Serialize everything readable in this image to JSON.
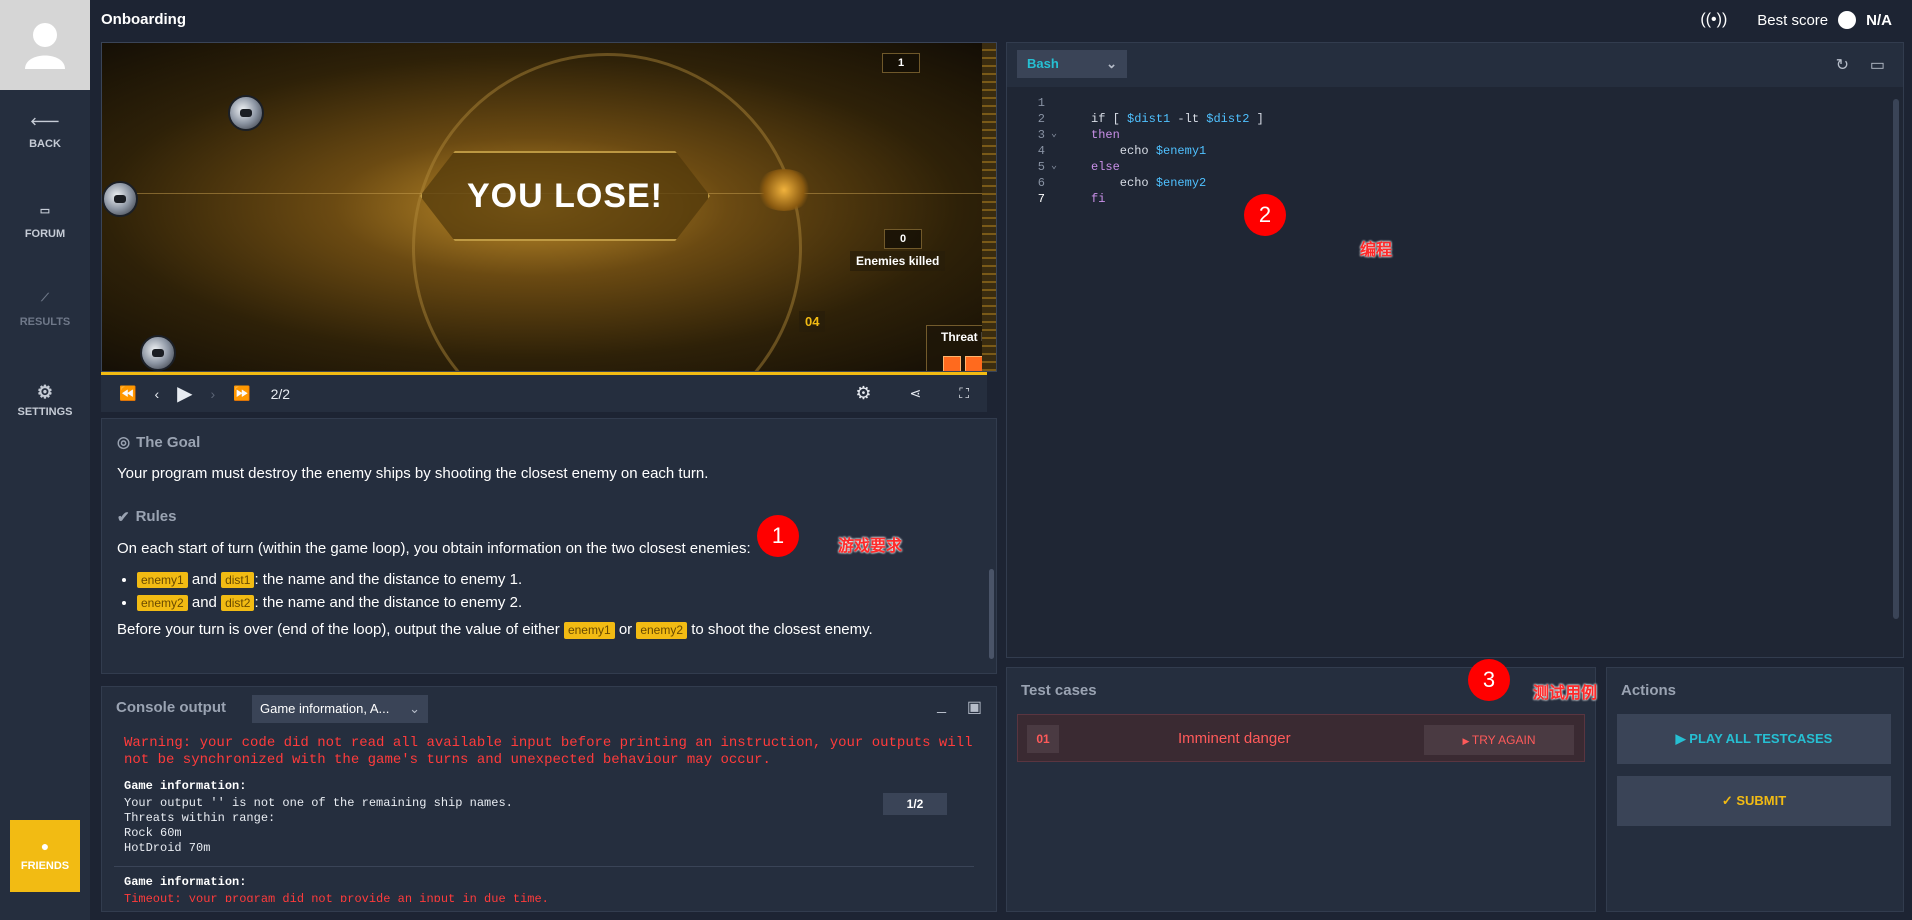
{
  "app": {
    "title": "Onboarding",
    "best_score_label": "Best score",
    "best_score_value": "N/A"
  },
  "sidebar": {
    "items": [
      {
        "label": "BACK",
        "icon": "arrow-left-icon"
      },
      {
        "label": "FORUM",
        "icon": "forum-icon"
      },
      {
        "label": "RESULTS",
        "icon": "chart-line-icon"
      },
      {
        "label": "SETTINGS",
        "icon": "gear-icon"
      }
    ],
    "friends_label": "FRIENDS"
  },
  "viewer": {
    "lose_text": "YOU LOSE!",
    "enemies_killed_label": "Enemies killed",
    "enemies_in_zone_count": "1",
    "enemies_killed_count": "0",
    "threat_label": "Threat level",
    "threat_number": "04",
    "frame": "2/2"
  },
  "statement": {
    "goal_title": "The Goal",
    "goal_text": "Your program must destroy the enemy ships by shooting the closest enemy on each turn.",
    "rules_title": "Rules",
    "rules_intro": "On each start of turn (within the game loop), you obtain information on the two closest enemies:",
    "bullet1": {
      "a": "enemy1",
      "and": "and",
      "b": "dist1",
      "text": ": the name and the distance to enemy 1."
    },
    "bullet2": {
      "a": "enemy2",
      "and": "and",
      "b": "dist2",
      "text": ": the name and the distance to enemy 2."
    },
    "outro_pre": "Before your turn is over (end of the loop), output the value of either",
    "outro_a": "enemy1",
    "outro_or": "or",
    "outro_b": "enemy2",
    "outro_post": "to shoot the closest enemy."
  },
  "console": {
    "title": "Console output",
    "select_value": "Game information, A...",
    "warning": "Warning: your code did not read all available input before printing an instruction, your outputs will not be synchronized with the game's turns and unexpected behaviour may occur.",
    "block1_title": "Game information:",
    "block1_lines": [
      "Your output '' is not one of the remaining ship names.",
      "Threats within range:",
      "Rock 60m",
      "HotDroid 70m"
    ],
    "frame_badge": "1/2",
    "block2_title": "Game information:",
    "block2_line": "Timeout: your program did not provide an input in due time."
  },
  "editor": {
    "language": "Bash",
    "lines": [
      {
        "n": "1",
        "parts": []
      },
      {
        "n": "2",
        "parts": [
          [
            "plain",
            "if [ "
          ],
          [
            "var",
            "$dist1"
          ],
          [
            "plain",
            " -lt "
          ],
          [
            "var",
            "$dist2"
          ],
          [
            "plain",
            " ]"
          ]
        ]
      },
      {
        "n": "3",
        "parts": [
          [
            "kw",
            "then"
          ]
        ]
      },
      {
        "n": "4",
        "parts": [
          [
            "plain",
            "    echo "
          ],
          [
            "var",
            "$enemy1"
          ]
        ]
      },
      {
        "n": "5",
        "parts": [
          [
            "kw",
            "else"
          ]
        ]
      },
      {
        "n": "6",
        "parts": [
          [
            "plain",
            "    echo "
          ],
          [
            "var",
            "$enemy2"
          ]
        ]
      },
      {
        "n": "7",
        "parts": [
          [
            "kw",
            "fi"
          ]
        ]
      }
    ]
  },
  "testcases": {
    "title": "Test cases",
    "items": [
      {
        "num": "01",
        "name": "Imminent danger",
        "action": "TRY AGAIN"
      }
    ]
  },
  "actions": {
    "title": "Actions",
    "play_all": "PLAY ALL TESTCASES",
    "submit": "SUBMIT"
  },
  "annotations": [
    {
      "num": "1",
      "note": "游戏要求"
    },
    {
      "num": "2",
      "note": "编程"
    },
    {
      "num": "3",
      "note": "测试用例"
    }
  ]
}
